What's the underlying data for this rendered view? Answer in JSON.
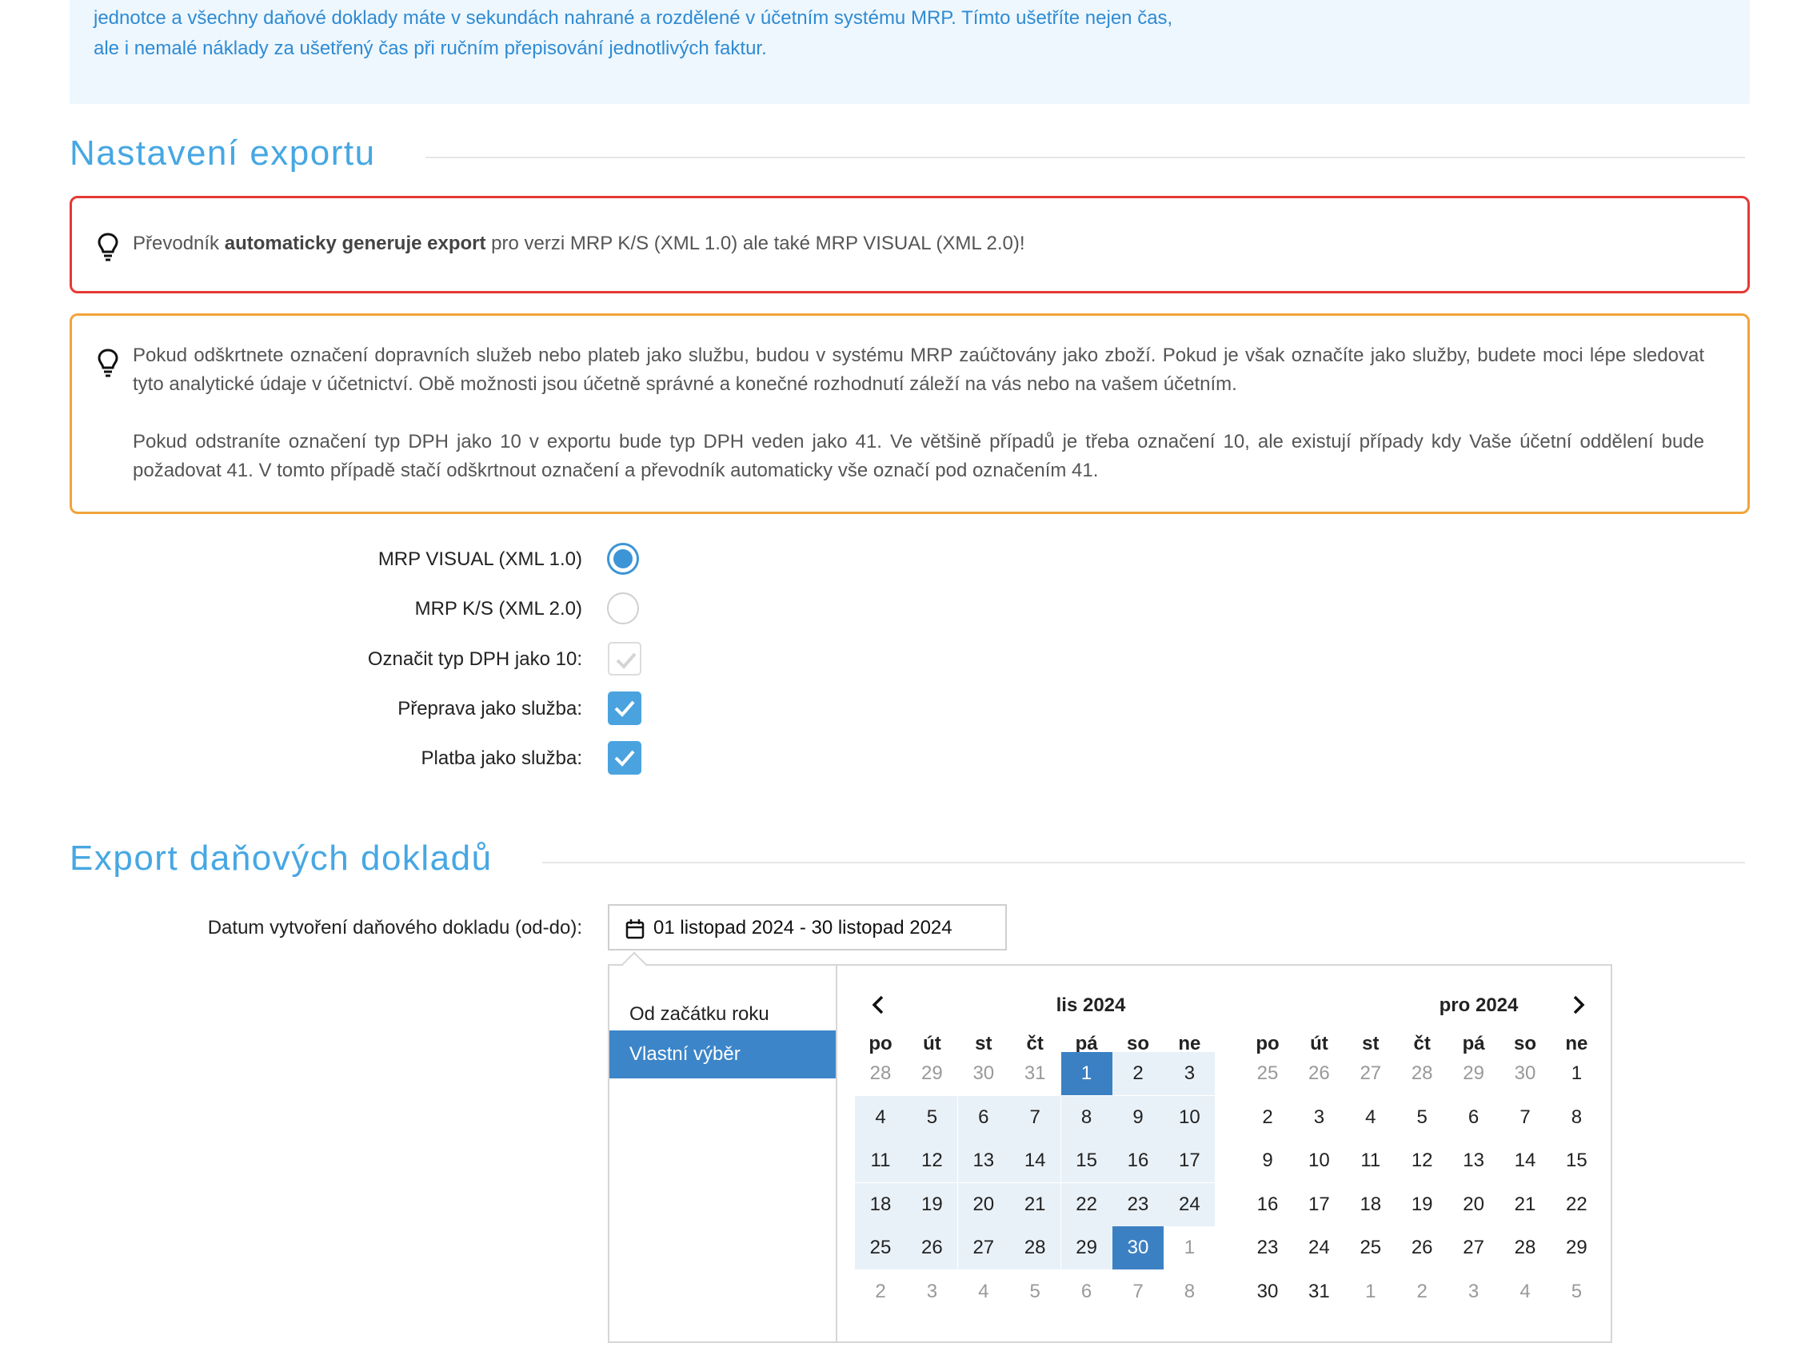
{
  "intro": {
    "line1": "jednotce a všechny daňové doklady máte v sekundách nahrané a rozdělené v účetním systému MRP. Tímto ušetříte nejen čas,",
    "line2": "ale i nemalé náklady za ušetřený čas při ručním přepisování jednotlivých faktur."
  },
  "settings": {
    "title": "Nastavení exportu",
    "alert_red": {
      "icon": "lightbulb-icon",
      "pre": "Převodník ",
      "bold": "automaticky generuje export",
      "post": " pro verzi MRP K/S (XML 1.0) ale také MRP VISUAL (XML 2.0)!"
    },
    "alert_orange": {
      "icon": "lightbulb-icon",
      "p1": "Pokud odškrtnete označení dopravních služeb nebo plateb jako službu, budou v systému MRP zaúčtovány jako zboží. Pokud je však označíte jako služby, budete moci lépe sledovat tyto analytické údaje v účetnictví. Obě možnosti jsou účetně správné a konečné rozhodnutí záleží na vás nebo na vašem účetním.",
      "p2": "Pokud odstraníte označení typ DPH jako 10 v exportu bude typ DPH veden jako 41. Ve většině případů je třeba označení 10, ale existují případy kdy Vaše účetní oddělení bude požadovat 41. V tomto případě stačí odškrtnout označení a převodník automaticky vše označí pod označením 41."
    },
    "options": [
      {
        "label": "MRP VISUAL (XML 1.0)",
        "type": "radio",
        "checked": true
      },
      {
        "label": "MRP K/S (XML 2.0)",
        "type": "radio",
        "checked": false
      },
      {
        "label": "Označit typ DPH jako 10:",
        "type": "checkbox",
        "checked": false
      },
      {
        "label": "Přeprava jako služba:",
        "type": "checkbox",
        "checked": true
      },
      {
        "label": "Platba jako služba:",
        "type": "checkbox",
        "checked": true
      }
    ]
  },
  "export": {
    "title": "Export daňových dokladů",
    "date_label": "Datum vytvoření daňového dokladu (od-do):",
    "date_value": "01 listopad 2024 - 30 listopad 2024",
    "date_icon": "calendar-icon"
  },
  "picker": {
    "ranges": [
      "Od začátku roku",
      "Vlastní výběr"
    ],
    "active_range": 1,
    "weekdays": [
      "po",
      "út",
      "st",
      "čt",
      "pá",
      "so",
      "ne"
    ],
    "left": {
      "title": "lis 2024",
      "weeks": [
        [
          28,
          29,
          30,
          31,
          1,
          2,
          3
        ],
        [
          4,
          5,
          6,
          7,
          8,
          9,
          10
        ],
        [
          11,
          12,
          13,
          14,
          15,
          16,
          17
        ],
        [
          18,
          19,
          20,
          21,
          22,
          23,
          24
        ],
        [
          25,
          26,
          27,
          28,
          29,
          30,
          1
        ],
        [
          2,
          3,
          4,
          5,
          6,
          7,
          8
        ]
      ]
    },
    "right": {
      "title": "pro 2024",
      "weeks": [
        [
          25,
          26,
          27,
          28,
          29,
          30,
          1
        ],
        [
          2,
          3,
          4,
          5,
          6,
          7,
          8
        ],
        [
          9,
          10,
          11,
          12,
          13,
          14,
          15
        ],
        [
          16,
          17,
          18,
          19,
          20,
          21,
          22
        ],
        [
          23,
          24,
          25,
          26,
          27,
          28,
          29
        ],
        [
          30,
          31,
          1,
          2,
          3,
          4,
          5
        ]
      ]
    },
    "prev_icon": "chevron-left-icon",
    "next_icon": "chevron-right-icon",
    "colors": {
      "selected": "#3c80c4",
      "in_range": "#e9f1f8",
      "accent": "#46a7e3"
    }
  }
}
